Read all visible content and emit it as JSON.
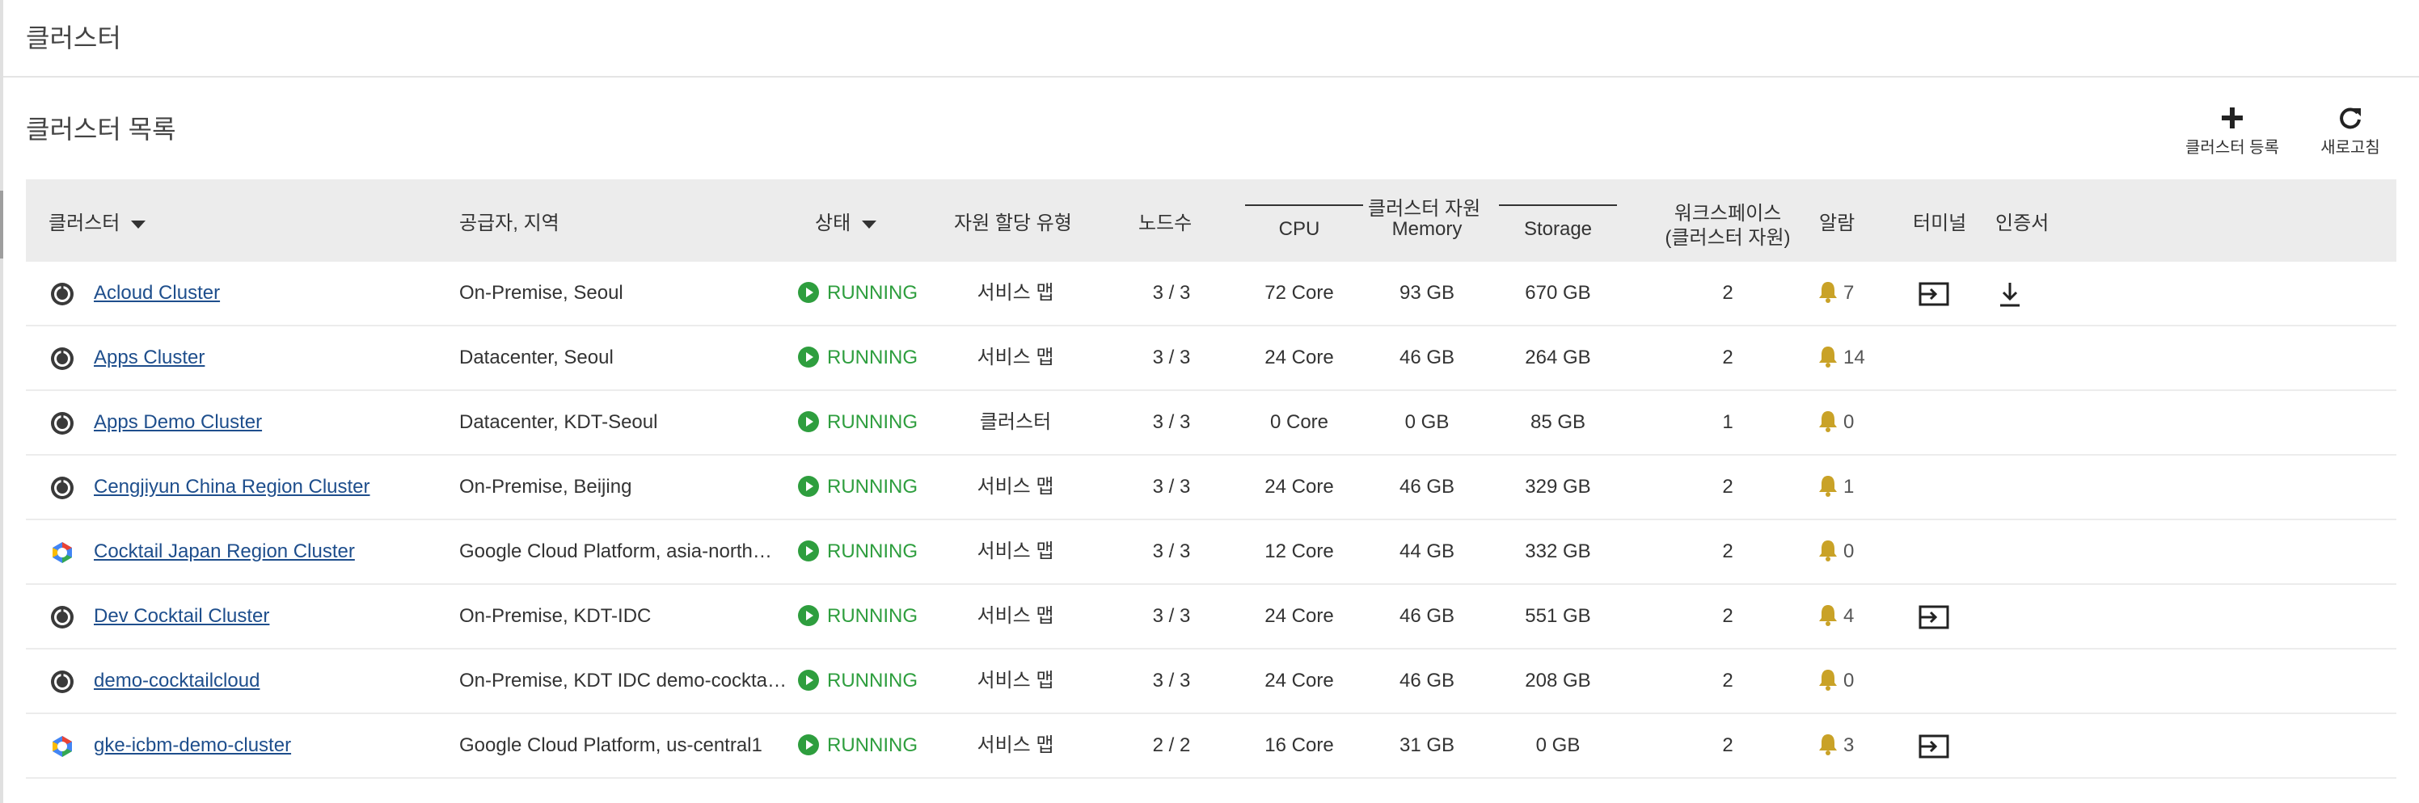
{
  "page": {
    "title": "클러스터"
  },
  "section": {
    "title": "클러스터 목록",
    "actions": [
      {
        "label": "클러스터 등록",
        "icon": "plus-icon"
      },
      {
        "label": "새로고침",
        "icon": "refresh-icon"
      }
    ]
  },
  "colors": {
    "accent": "#1e4e8c",
    "running": "#2e9e3e",
    "bell": "#c9a227",
    "header_bg": "#ececec"
  },
  "table": {
    "headers": {
      "cluster": "클러스터",
      "provider": "공급자, 지역",
      "status": "상태",
      "alloc_type": "자원 할당 유형",
      "nodes": "노드수",
      "resource_group": "클러스터 자원",
      "cpu": "CPU",
      "memory": "Memory",
      "storage": "Storage",
      "workspace_line1": "워크스페이스",
      "workspace_line2": "(클러스터 자원)",
      "alarm": "알람",
      "terminal": "터미널",
      "cert": "인증서"
    },
    "rows": [
      {
        "name": "Acloud Cluster",
        "provider_icon": "kubernetes-icon",
        "provider": "On-Premise, Seoul",
        "status": "RUNNING",
        "alloc_type": "서비스 맵",
        "nodes": "3 / 3",
        "cpu": "72 Core",
        "memory": "93 GB",
        "storage": "670 GB",
        "workspace": "2",
        "alarm": "7",
        "terminal": true,
        "cert": true
      },
      {
        "name": "Apps Cluster",
        "provider_icon": "kubernetes-icon",
        "provider": "Datacenter, Seoul",
        "status": "RUNNING",
        "alloc_type": "서비스 맵",
        "nodes": "3 / 3",
        "cpu": "24 Core",
        "memory": "46 GB",
        "storage": "264 GB",
        "workspace": "2",
        "alarm": "14",
        "terminal": false,
        "cert": false
      },
      {
        "name": "Apps Demo Cluster",
        "provider_icon": "kubernetes-icon",
        "provider": "Datacenter, KDT-Seoul",
        "status": "RUNNING",
        "alloc_type": "클러스터",
        "nodes": "3 / 3",
        "cpu": "0 Core",
        "memory": "0 GB",
        "storage": "85 GB",
        "workspace": "1",
        "alarm": "0",
        "terminal": false,
        "cert": false
      },
      {
        "name": "Cengjiyun China Region Cluster",
        "provider_icon": "kubernetes-icon",
        "provider": "On-Premise, Beijing",
        "status": "RUNNING",
        "alloc_type": "서비스 맵",
        "nodes": "3 / 3",
        "cpu": "24 Core",
        "memory": "46 GB",
        "storage": "329 GB",
        "workspace": "2",
        "alarm": "1",
        "terminal": false,
        "cert": false
      },
      {
        "name": "Cocktail Japan Region Cluster",
        "provider_icon": "google-cloud-icon",
        "provider": "Google Cloud Platform, asia-north…",
        "status": "RUNNING",
        "alloc_type": "서비스 맵",
        "nodes": "3 / 3",
        "cpu": "12 Core",
        "memory": "44 GB",
        "storage": "332 GB",
        "workspace": "2",
        "alarm": "0",
        "terminal": false,
        "cert": false
      },
      {
        "name": "Dev Cocktail Cluster",
        "provider_icon": "kubernetes-icon",
        "provider": "On-Premise, KDT-IDC",
        "status": "RUNNING",
        "alloc_type": "서비스 맵",
        "nodes": "3 / 3",
        "cpu": "24 Core",
        "memory": "46 GB",
        "storage": "551 GB",
        "workspace": "2",
        "alarm": "4",
        "terminal": true,
        "cert": false
      },
      {
        "name": "demo-cocktailcloud",
        "provider_icon": "kubernetes-icon",
        "provider": "On-Premise, KDT IDC demo-cockta…",
        "status": "RUNNING",
        "alloc_type": "서비스 맵",
        "nodes": "3 / 3",
        "cpu": "24 Core",
        "memory": "46 GB",
        "storage": "208 GB",
        "workspace": "2",
        "alarm": "0",
        "terminal": false,
        "cert": false
      },
      {
        "name": "gke-icbm-demo-cluster",
        "provider_icon": "google-cloud-icon",
        "provider": "Google Cloud Platform, us-central1",
        "status": "RUNNING",
        "alloc_type": "서비스 맵",
        "nodes": "2 / 2",
        "cpu": "16 Core",
        "memory": "31 GB",
        "storage": "0 GB",
        "workspace": "2",
        "alarm": "3",
        "terminal": true,
        "cert": false
      }
    ]
  }
}
